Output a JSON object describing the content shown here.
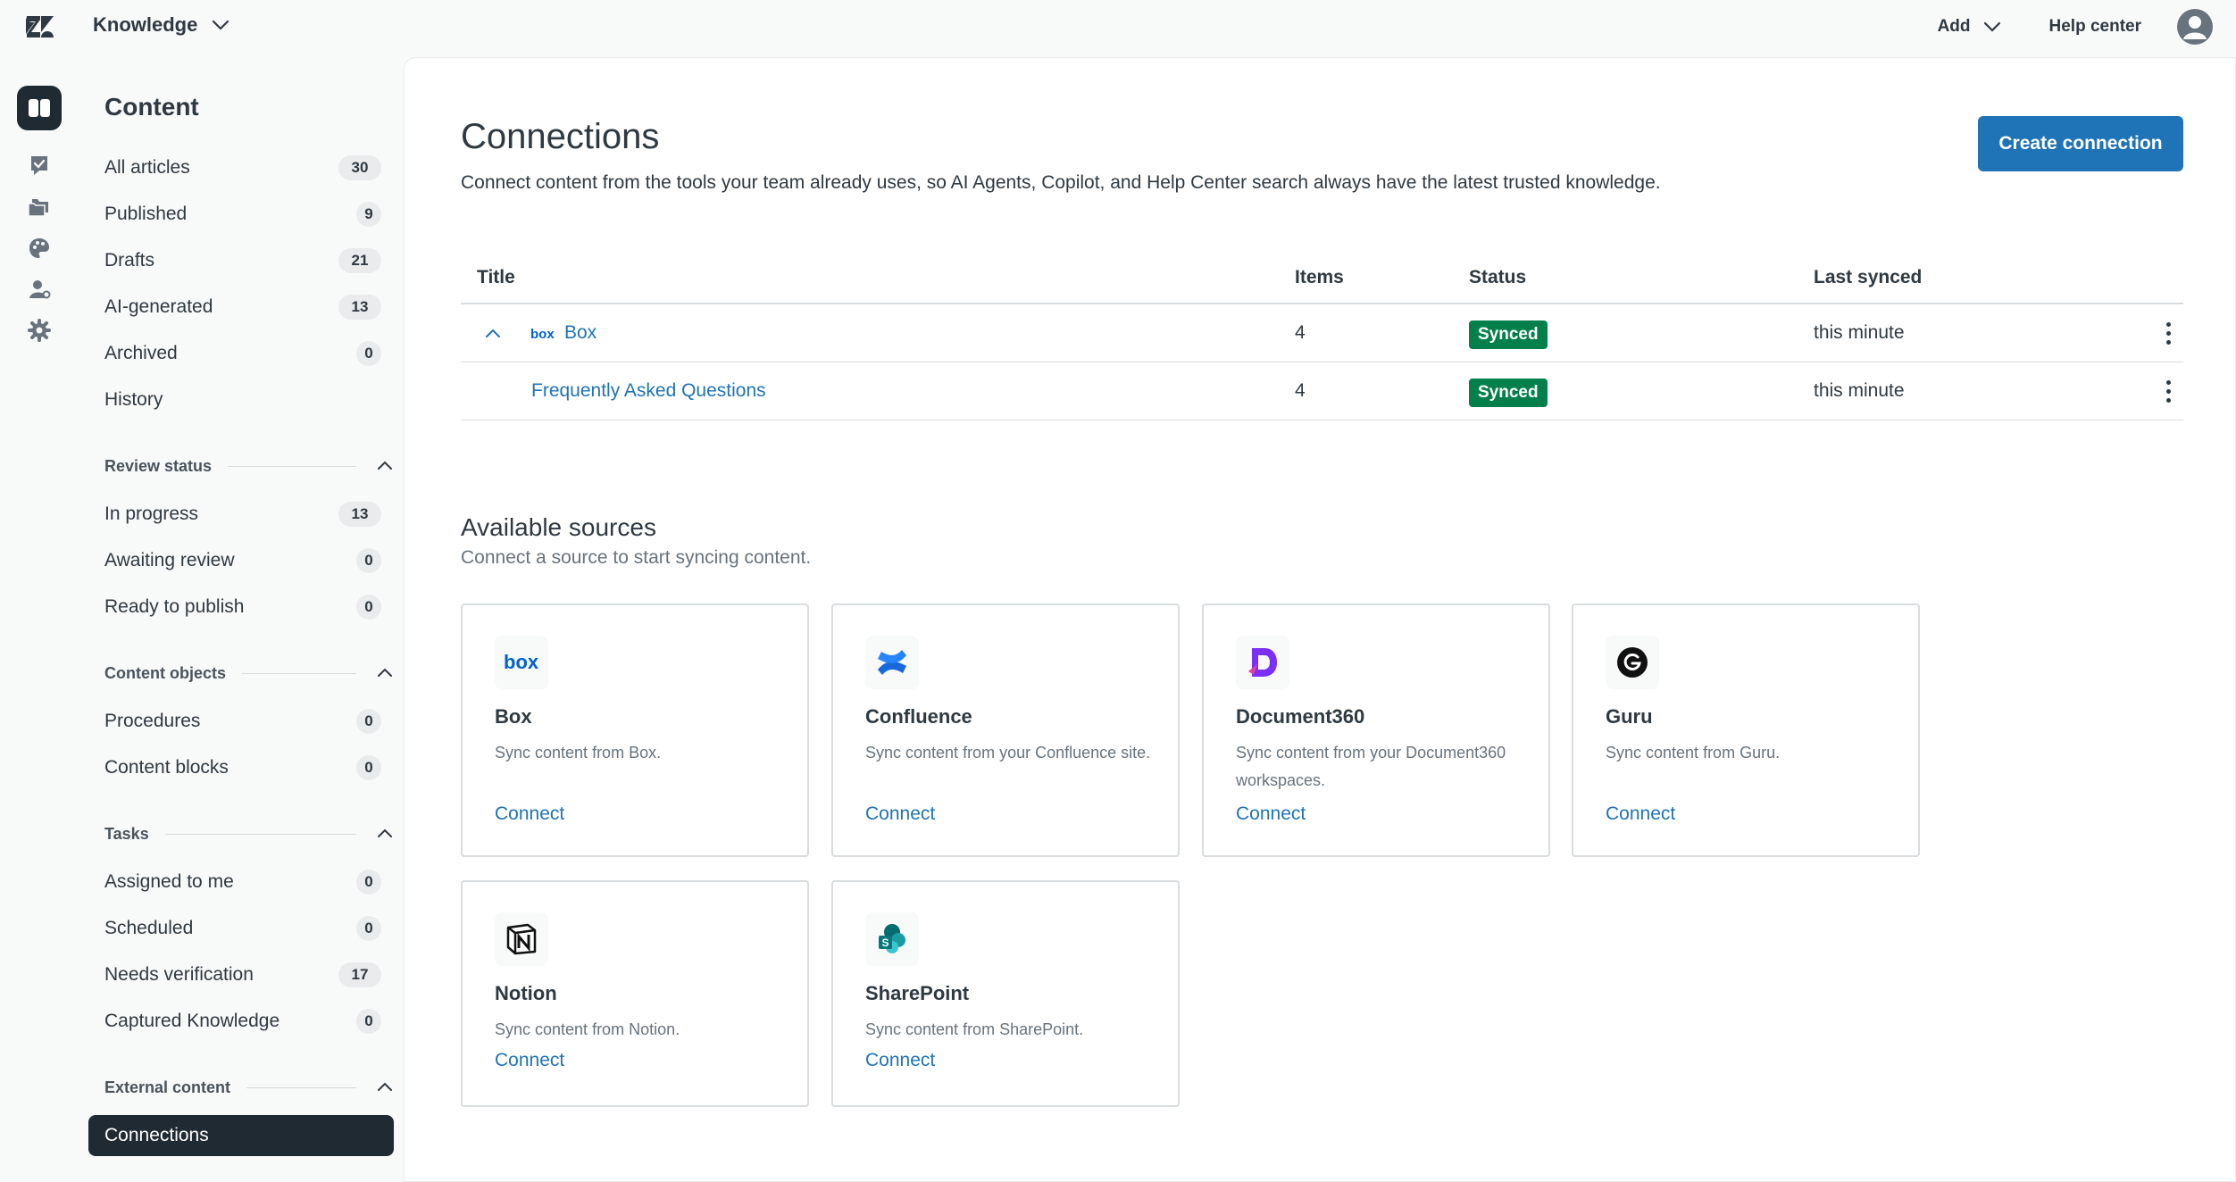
{
  "topbar": {
    "product": "Knowledge",
    "add_label": "Add",
    "help_center_label": "Help center"
  },
  "sidebar": {
    "title": "Content",
    "items": [
      {
        "label": "All articles",
        "count": "30"
      },
      {
        "label": "Published",
        "count": "9"
      },
      {
        "label": "Drafts",
        "count": "21"
      },
      {
        "label": "AI-generated",
        "count": "13"
      },
      {
        "label": "Archived",
        "count": "0"
      },
      {
        "label": "History",
        "count": ""
      }
    ],
    "review_status": {
      "title": "Review status",
      "items": [
        {
          "label": "In progress",
          "count": "13"
        },
        {
          "label": "Awaiting review",
          "count": "0"
        },
        {
          "label": "Ready to publish",
          "count": "0"
        }
      ]
    },
    "content_objects": {
      "title": "Content objects",
      "items": [
        {
          "label": "Procedures",
          "count": "0"
        },
        {
          "label": "Content blocks",
          "count": "0"
        }
      ]
    },
    "tasks": {
      "title": "Tasks",
      "items": [
        {
          "label": "Assigned to me",
          "count": "0"
        },
        {
          "label": "Scheduled",
          "count": "0"
        },
        {
          "label": "Needs verification",
          "count": "17"
        },
        {
          "label": "Captured Knowledge",
          "count": "0"
        }
      ]
    },
    "external_content": {
      "title": "External content",
      "items": [
        {
          "label": "Connections"
        }
      ]
    }
  },
  "main": {
    "title": "Connections",
    "description": "Connect content from the tools your team already uses, so AI Agents, Copilot, and Help Center search always have the latest trusted knowledge.",
    "create_button": "Create connection",
    "table": {
      "headers": [
        "Title",
        "Items",
        "Status",
        "Last synced"
      ],
      "rows": [
        {
          "title": "Box",
          "items": "4",
          "status": "Synced",
          "last_synced": "this minute",
          "logo": "box"
        },
        {
          "title": "Frequently Asked Questions",
          "items": "4",
          "status": "Synced",
          "last_synced": "this minute"
        }
      ]
    },
    "available": {
      "title": "Available sources",
      "description": "Connect a source to start syncing content.",
      "connect_label": "Connect",
      "sources": [
        {
          "name": "Box",
          "description": "Sync content from Box.",
          "icon": "box-logo"
        },
        {
          "name": "Confluence",
          "description": "Sync content from your Confluence site.",
          "icon": "confluence-logo"
        },
        {
          "name": "Document360",
          "description": "Sync content from your Document360 workspaces.",
          "icon": "document360-logo"
        },
        {
          "name": "Guru",
          "description": "Sync content from Guru.",
          "icon": "guru-logo"
        },
        {
          "name": "Notion",
          "description": "Sync content from Notion.",
          "icon": "notion-logo"
        },
        {
          "name": "SharePoint",
          "description": "Sync content from SharePoint.",
          "icon": "sharepoint-logo"
        }
      ]
    }
  },
  "colors": {
    "accent": "#1f73b7",
    "synced": "#037f4c",
    "active_nav": "#1f2a33"
  }
}
